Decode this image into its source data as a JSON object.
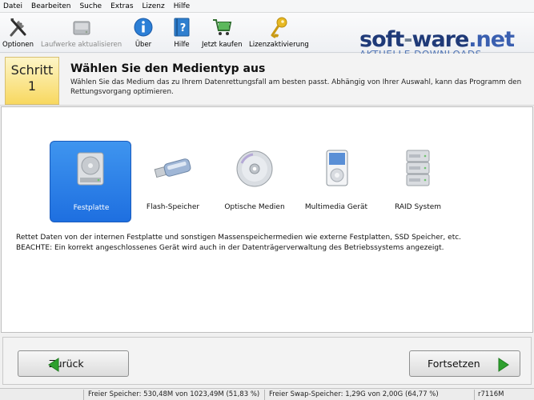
{
  "menu": [
    "Datei",
    "Bearbeiten",
    "Suche",
    "Extras",
    "Lizenz",
    "Hilfe"
  ],
  "toolbar": {
    "options": {
      "label": "Optionen",
      "icon": "tools-icon"
    },
    "refresh": {
      "label": "Laufwerke aktualisieren",
      "icon": "drive-refresh-icon"
    },
    "about": {
      "label": "Über",
      "icon": "info-icon"
    },
    "help": {
      "label": "Hilfe",
      "icon": "help-book-icon"
    },
    "buy": {
      "label": "Jetzt kaufen",
      "icon": "shopping-cart-icon"
    },
    "license": {
      "label": "Lizenzaktivierung",
      "icon": "key-icon"
    }
  },
  "logo": {
    "brand_a": "soft",
    "brand_b": "-",
    "brand_c": "ware",
    "brand_dot": ".net",
    "tagline": "AKTUELLE DOWNLOADS"
  },
  "step": {
    "label": "Schritt",
    "number": "1",
    "title": "Wählen Sie den Medientyp aus",
    "description": "Wählen Sie das Medium das zu Ihrem Datenrettungsfall am besten passt. Abhängig von Ihrer Auswahl, kann das Programm den Rettungsvorgang optimieren."
  },
  "media": {
    "hdd": "Festplatte",
    "flash": "Flash-Speicher",
    "optical": "Optische Medien",
    "multimedia": "Multimedia Gerät",
    "raid": "RAID System",
    "selected": "Festplatte"
  },
  "info": {
    "line1": "Rettet Daten von der internen Festplatte und sonstigen Massenspeichermedien wie externe Festplatten, SSD Speicher, etc.",
    "line2": "BEACHTE: Ein korrekt angeschlossenes Gerät wird auch in der Datenträgerverwaltung des Betriebssystems angezeigt."
  },
  "nav": {
    "back": "Zurück",
    "next": "Fortsetzen"
  },
  "status": {
    "free_memory": "Freier Speicher: 530,48M von 1023,49M (51,83 %)",
    "free_swap": "Freier Swap-Speicher: 1,29G von 2,00G (64,77 %)",
    "version": "r7116M"
  },
  "colors": {
    "selected_bg": "#2a7fe8",
    "step_box": "#f8d860",
    "arrow_green": "#2ea02e",
    "logo_blue": "#1f3a78"
  }
}
